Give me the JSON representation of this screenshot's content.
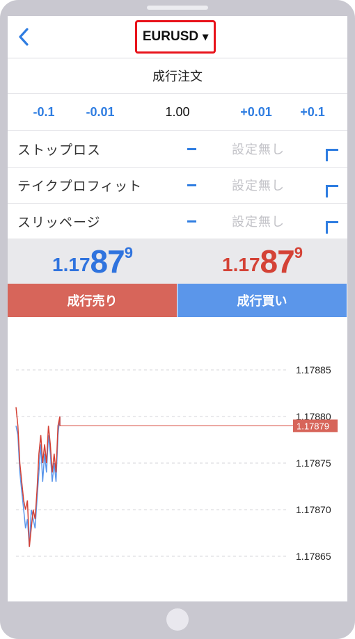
{
  "header": {
    "symbol": "EURUSD",
    "caret": "▾"
  },
  "title": "成行注文",
  "volume": {
    "minus_large": "-0.1",
    "minus_small": "-0.01",
    "value": "1.00",
    "plus_small": "+0.01",
    "plus_large": "+0.1"
  },
  "settings": [
    {
      "label": "ストップロス",
      "value": "設定無し"
    },
    {
      "label": "テイクプロフィット",
      "value": "設定無し"
    },
    {
      "label": "スリッページ",
      "value": "設定無し"
    }
  ],
  "quote": {
    "bid": {
      "small": "1.17",
      "big": "87",
      "pip": "9"
    },
    "ask": {
      "small": "1.17",
      "big": "87",
      "pip": "9"
    }
  },
  "buttons": {
    "sell": "成行売り",
    "buy": "成行買い"
  },
  "colors": {
    "accent": "#2f7de1",
    "bid": "#2f73de",
    "ask": "#d44236",
    "sell_button": "#d7655a",
    "buy_button": "#5b96ea",
    "current_price_label": "#d7655a",
    "highlight_border": "#e8131b"
  },
  "chart_data": {
    "type": "line",
    "ylim": [
      1.17862,
      1.17891
    ],
    "yticks": [
      "1.17885",
      "1.17880",
      "1.17875",
      "1.17870",
      "1.17865"
    ],
    "grid": true,
    "current_price": "1.17879",
    "series": [
      {
        "color": "#5b96ea",
        "values": [
          1.17879,
          1.17878,
          1.17874,
          1.17872,
          1.1787,
          1.17868,
          1.17869,
          1.17866,
          1.1787,
          1.17869,
          1.17868,
          1.17871,
          1.17874,
          1.17877,
          1.17873,
          1.17876,
          1.17874,
          1.17878,
          1.17876,
          1.17873,
          1.17875,
          1.17873,
          1.17878,
          1.1788,
          1.17879,
          1.17879,
          1.17879,
          1.17879,
          1.17879
        ]
      },
      {
        "color": "#d44236",
        "values": [
          1.17881,
          1.17879,
          1.17875,
          1.17873,
          1.17871,
          1.1787,
          1.17871,
          1.17866,
          1.17868,
          1.1787,
          1.17869,
          1.17872,
          1.17876,
          1.17878,
          1.17875,
          1.17877,
          1.17875,
          1.17879,
          1.17877,
          1.17874,
          1.17876,
          1.17874,
          1.17879,
          1.1788,
          1.17879,
          1.17879,
          1.17879,
          1.17879,
          1.17879
        ]
      }
    ]
  }
}
